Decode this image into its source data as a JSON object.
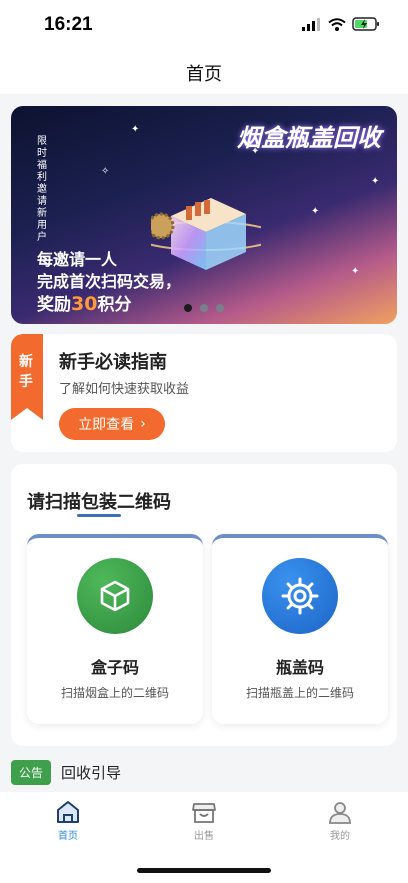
{
  "status_bar": {
    "time": "16:21"
  },
  "nav": {
    "title": "首页"
  },
  "banner": {
    "title": "烟盒瓶盖回收",
    "vertical_text": "限时福利 邀请新用户",
    "line1": "每邀请一人",
    "line2": "完成首次扫码交易，",
    "line3_prefix": "奖励",
    "line3_highlight": "30",
    "line3_suffix": "积分",
    "dots": 3,
    "active_dot": 0
  },
  "guide": {
    "ribbon": "新手",
    "title": "新手必读指南",
    "subtitle": "了解如何快速获取收益",
    "button_label": "立即查看",
    "button_arrow": "›"
  },
  "scan": {
    "title": "请扫描包装二维码",
    "tiles": [
      {
        "name": "盒子码",
        "desc": "扫描烟盒上的二维码",
        "icon": "box-icon",
        "color": "#2d8a3c"
      },
      {
        "name": "瓶盖码",
        "desc": "扫描瓶盖上的二维码",
        "icon": "cap-gear-icon",
        "color": "#1c64c6"
      }
    ]
  },
  "notice": {
    "badge": "公告",
    "text": "回收引导"
  },
  "tab_bar": {
    "items": [
      {
        "label": "首页",
        "icon": "home-icon",
        "active": true
      },
      {
        "label": "出售",
        "icon": "shop-icon",
        "active": false
      },
      {
        "label": "我的",
        "icon": "user-icon",
        "active": false
      }
    ]
  },
  "colors": {
    "accent_orange": "#f26a2e",
    "tab_active": "#2e8bd6",
    "notice_green": "#3ea04b"
  }
}
